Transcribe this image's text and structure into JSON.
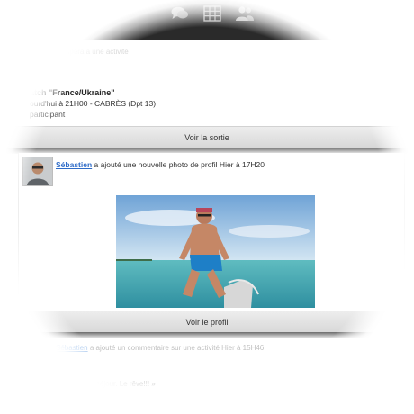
{
  "nav": {
    "icons": [
      "chat-bubbles-icon",
      "grid-icon",
      "users-icon"
    ]
  },
  "card_top": {
    "faded_line": "participera à une activité",
    "title": "atch \"France/Ukraine\"",
    "when": "ourd'hui à 21H00 - CABRÈS (Dpt 13)",
    "participants": "participant"
  },
  "buttons": {
    "see_outing": "Voir la sortie",
    "see_profile": "Voir le profil"
  },
  "post": {
    "author": "Sébastien",
    "text": " a ajouté une nouvelle photo de profil Hier à 17H20"
  },
  "card_bottom": {
    "author": "Sébastien",
    "text": " a ajouté un commentaire sur une activité Hier à 15H46",
    "quote": "« ... s du séjour. Le rêve!!! »"
  },
  "colors": {
    "topbar": "#2a2a2a",
    "link": "#2f6cc8",
    "button_bg": "#e3e3e3"
  }
}
